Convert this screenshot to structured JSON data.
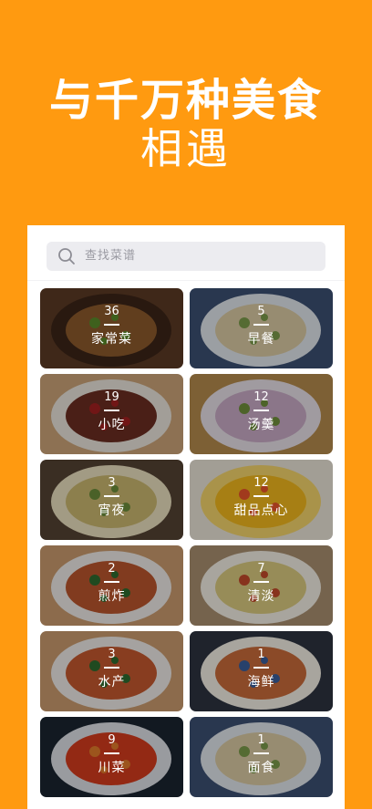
{
  "hero": {
    "line1": "与千万种美食",
    "line2": "相遇"
  },
  "search": {
    "placeholder": "查找菜谱"
  },
  "categories": [
    {
      "count": "36",
      "name": "家常菜",
      "plate": "#3b2418",
      "food": "#8c5a2c",
      "garnish": "#5a8a2a",
      "bg": "#5b3a24"
    },
    {
      "count": "5",
      "name": "早餐",
      "plate": "#dfe4ea",
      "food": "#d9c9a2",
      "garnish": "#7a9a4a",
      "bg": "#3c4f72"
    },
    {
      "count": "19",
      "name": "小吃",
      "plate": "#e8e3da",
      "food": "#6a2d22",
      "garnish": "#a32020",
      "bg": "#caa277"
    },
    {
      "count": "12",
      "name": "汤羹",
      "plate": "#e6dfe6",
      "food": "#c7a9c4",
      "garnish": "#6f8f3c",
      "bg": "#b48a4c"
    },
    {
      "count": "3",
      "name": "宵夜",
      "plate": "#e9dfbe",
      "food": "#c9b66f",
      "garnish": "#6a8c3a",
      "bg": "#544233"
    },
    {
      "count": "12",
      "name": "甜品点心",
      "plate": "#f2d36b",
      "food": "#f0b71d",
      "garnish": "#e7532a",
      "bg": "#e9e2d6"
    },
    {
      "count": "2",
      "name": "煎炸",
      "plate": "#ece9e6",
      "food": "#b9552d",
      "garnish": "#2f6b2e",
      "bg": "#c99a6d"
    },
    {
      "count": "7",
      "name": "清淡",
      "plate": "#f1ece2",
      "food": "#d9c97f",
      "garnish": "#c24a2a",
      "bg": "#a88e6f"
    },
    {
      "count": "3",
      "name": "水产",
      "plate": "#ece9e6",
      "food": "#c3582e",
      "garnish": "#2f6b2e",
      "bg": "#c99a6d"
    },
    {
      "count": "1",
      "name": "海鲜",
      "plate": "#f1ece2",
      "food": "#c86a3a",
      "garnish": "#3a5e9a",
      "bg": "#2d3340"
    },
    {
      "count": "9",
      "name": "川菜",
      "plate": "#dcdfe4",
      "food": "#d33b1e",
      "garnish": "#e07a2a",
      "bg": "#1b2430"
    },
    {
      "count": "1",
      "name": "面食",
      "plate": "#dfe4ea",
      "food": "#d9c9a2",
      "garnish": "#7a9a4a",
      "bg": "#3c4f72"
    }
  ],
  "colors": {
    "brand": "#FF9A10",
    "panel": "#FFFFFF",
    "search_bg": "#ECECF0"
  }
}
